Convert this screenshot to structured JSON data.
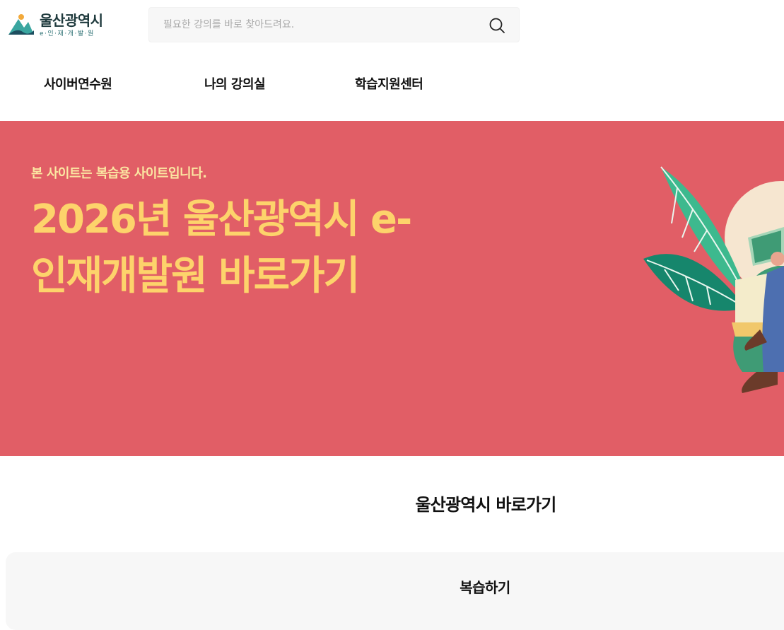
{
  "logo": {
    "title": "울산광역시",
    "subtitle": "e·인·재·개·발·원"
  },
  "search": {
    "placeholder": "필요한 강의를 바로 찾아드려요.",
    "icon": "search-icon"
  },
  "nav": {
    "items": [
      {
        "label": "사이버연수원"
      },
      {
        "label": "나의 강의실"
      },
      {
        "label": "학습지원센터"
      }
    ]
  },
  "hero": {
    "subtitle": "본 사이트는 복습용 사이트입니다.",
    "title_line1": "2026년 울산광역시 e-",
    "title_line2": "인재개발원 바로가기",
    "background_color": "#e15e66",
    "title_color": "#fdd36b",
    "subtitle_color": "#fbe7a2"
  },
  "section": {
    "title": "울산광역시 바로가기"
  },
  "review": {
    "label": "복습하기"
  }
}
